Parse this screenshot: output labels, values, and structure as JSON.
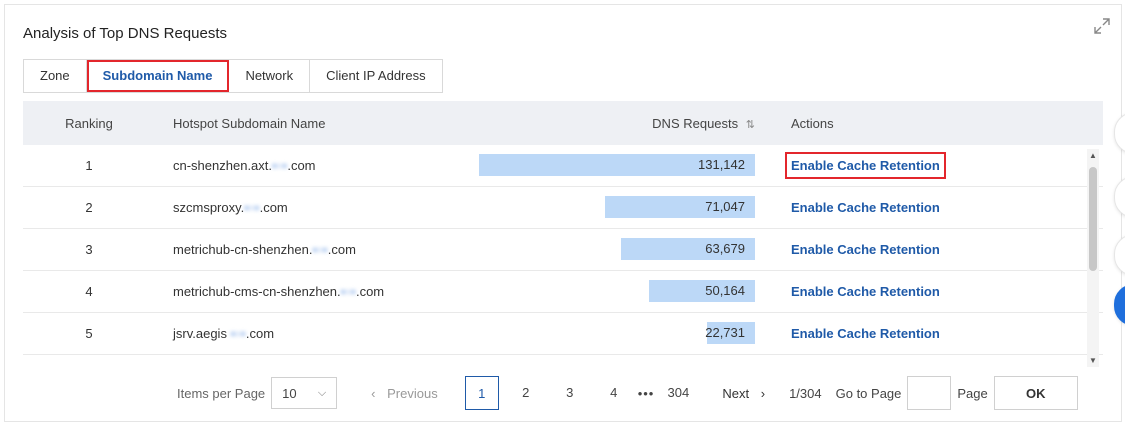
{
  "panel": {
    "title": "Analysis of Top DNS Requests",
    "expand_icon": "expand-icon"
  },
  "tabs": [
    {
      "label": "Zone"
    },
    {
      "label": "Subdomain Name"
    },
    {
      "label": "Network"
    },
    {
      "label": "Client IP Address"
    }
  ],
  "table": {
    "headers": {
      "ranking": "Ranking",
      "name": "Hotspot Subdomain Name",
      "requests": "DNS Requests",
      "sort_icon": "sort-icon",
      "actions": "Actions"
    },
    "rows": [
      {
        "rank": "1",
        "name_prefix": "cn-shenzhen.axt.",
        "name_suffix": ".com",
        "requests": "131,142",
        "fraction": 1.0,
        "action": "Enable Cache Retention"
      },
      {
        "rank": "2",
        "name_prefix": "szcmsproxy.",
        "name_suffix": ".com",
        "requests": "71,047",
        "fraction": 0.542,
        "action": "Enable Cache Retention"
      },
      {
        "rank": "3",
        "name_prefix": "metrichub-cn-shenzhen.",
        "name_suffix": ".com",
        "requests": "63,679",
        "fraction": 0.486,
        "action": "Enable Cache Retention"
      },
      {
        "rank": "4",
        "name_prefix": "metrichub-cms-cn-shenzhen.",
        "name_suffix": ".com",
        "requests": "50,164",
        "fraction": 0.383,
        "action": "Enable Cache Retention"
      },
      {
        "rank": "5",
        "name_prefix": "jsrv.aegis ",
        "name_suffix": ".com",
        "requests": "22,731",
        "fraction": 0.173,
        "action": "Enable Cache Retention"
      }
    ]
  },
  "pagination": {
    "items_per_page_label": "Items per Page",
    "items_per_page_value": "10",
    "prev": "Previous",
    "pages": [
      "1",
      "2",
      "3",
      "4"
    ],
    "ellipsis": "•••",
    "last_page": "304",
    "next": "Next",
    "counter": "1/304",
    "goto_label": "Go to Page",
    "page_label": "Page",
    "ok": "OK"
  },
  "colors": {
    "accent": "#1f5aa8",
    "bar": "#bcd8f7",
    "highlight": "#e3262c"
  }
}
